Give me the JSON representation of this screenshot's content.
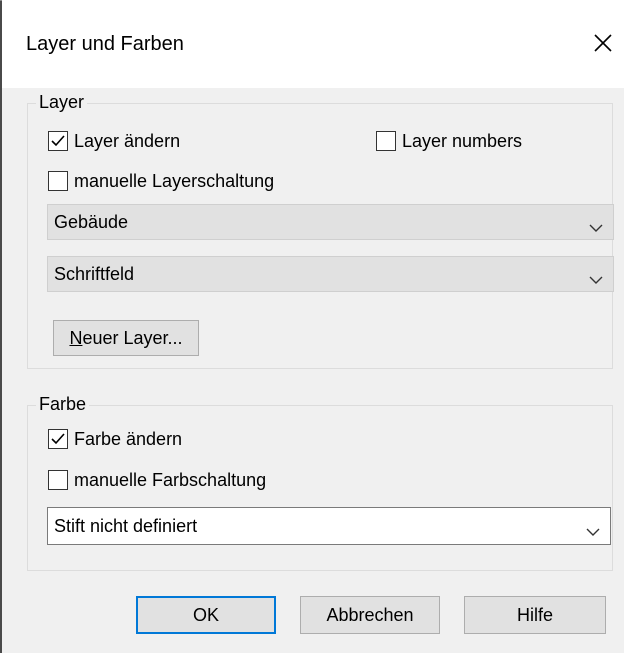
{
  "dialog": {
    "title": "Layer und Farben"
  },
  "layer_group": {
    "label": "Layer",
    "change_layer": {
      "label": "Layer ändern",
      "checked": true
    },
    "layer_numbers": {
      "label": "Layer numbers",
      "checked": false
    },
    "manual_switching": {
      "label": "manuelle Layerschaltung",
      "checked": false
    },
    "combo1": {
      "value": "Gebäude"
    },
    "combo2": {
      "value": "Schriftfeld"
    },
    "new_layer_button": {
      "mnemonic": "N",
      "rest": "euer Layer..."
    }
  },
  "color_group": {
    "label": "Farbe",
    "change_color": {
      "label": "Farbe ändern",
      "checked": true
    },
    "manual_switching": {
      "label": "manuelle Farbschaltung",
      "checked": false
    },
    "combo": {
      "value": "Stift nicht definiert"
    }
  },
  "buttons": {
    "ok": "OK",
    "cancel": "Abbrechen",
    "help": "Hilfe"
  },
  "colors": {
    "default_button_border": "#0078d7",
    "dialog_background": "#f0f0f0"
  }
}
